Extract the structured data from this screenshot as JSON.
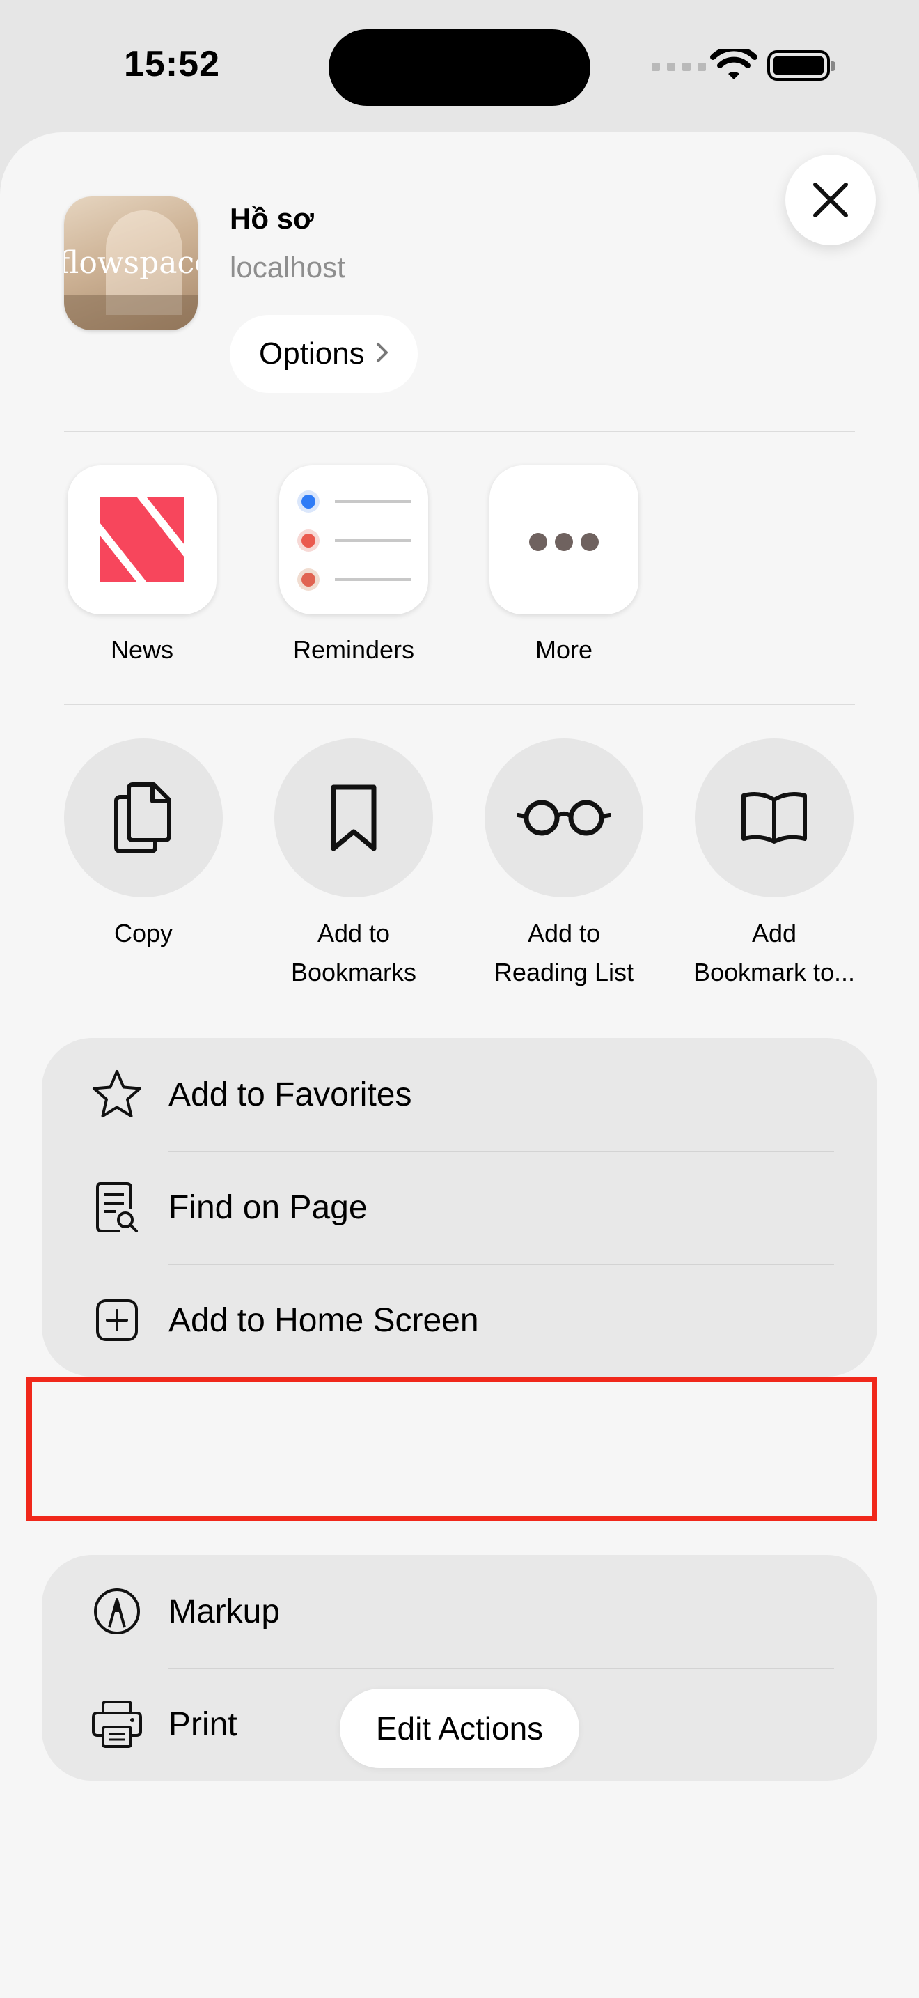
{
  "status_bar": {
    "time": "15:52"
  },
  "header": {
    "thumbnail_text": "flowspace",
    "title": "Hồ sơ",
    "host": "localhost",
    "options_label": "Options"
  },
  "apps": [
    {
      "label": "News",
      "icon": "news-icon"
    },
    {
      "label": "Reminders",
      "icon": "reminders-icon"
    },
    {
      "label": "More",
      "icon": "more-icon"
    }
  ],
  "actions": [
    {
      "line1": "Copy",
      "line2": "",
      "icon": "copy-icon"
    },
    {
      "line1": "Add to",
      "line2": "Bookmarks",
      "icon": "bookmark-icon"
    },
    {
      "line1": "Add to",
      "line2": "Reading List",
      "icon": "glasses-icon"
    },
    {
      "line1": "Add",
      "line2": "Bookmark to...",
      "icon": "book-icon"
    }
  ],
  "menu_group_1": [
    {
      "label": "Add to Favorites",
      "icon": "star-icon"
    },
    {
      "label": "Find on Page",
      "icon": "find-page-icon"
    },
    {
      "label": "Add to Home Screen",
      "icon": "add-square-icon"
    }
  ],
  "menu_group_2": [
    {
      "label": "Markup",
      "icon": "markup-icon"
    },
    {
      "label": "Print",
      "icon": "printer-icon"
    }
  ],
  "edit_actions_label": "Edit Actions",
  "colors": {
    "highlight": "#f0281b",
    "news_red": "#f7465c",
    "sheet": "#f6f6f6"
  }
}
